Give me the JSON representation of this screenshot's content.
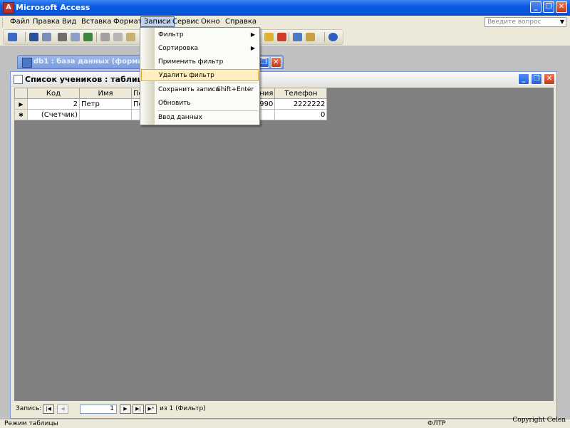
{
  "app": {
    "title": "Microsoft Access"
  },
  "window_buttons": {
    "minimize": "_",
    "restore": "❐",
    "close": "✕"
  },
  "menubar": {
    "items": [
      {
        "label": "Файл"
      },
      {
        "label": "Правка"
      },
      {
        "label": "Вид"
      },
      {
        "label": "Вставка"
      },
      {
        "label": "Формат"
      },
      {
        "label": "Записи"
      },
      {
        "label": "Сервис"
      },
      {
        "label": "Окно"
      },
      {
        "label": "Справка"
      }
    ],
    "help_placeholder": "Введите вопрос"
  },
  "db_window": {
    "title": "db1 : база данных (формат Ac"
  },
  "table_window": {
    "title": "Список учеников : таблица",
    "columns": [
      "Код",
      "Имя",
      "Пе",
      "ждения",
      "Телефон"
    ],
    "rows": [
      {
        "selector": "▶",
        "cells": [
          "2",
          "Петр",
          "Пе",
          "02.1990",
          "2222222"
        ]
      },
      {
        "selector": "✱",
        "cells": [
          "(Счетчик)",
          "",
          "",
          "",
          "0"
        ]
      }
    ]
  },
  "navigator": {
    "label": "Запись:",
    "current": "1",
    "of_text": "из 1 (Фильтр)",
    "buttons": {
      "first": "|◀",
      "prev": "◀",
      "next": "▶",
      "last": "▶|",
      "new": "▶*"
    }
  },
  "dropdown": {
    "items": [
      {
        "label": "Фильтр",
        "submenu": true
      },
      {
        "label": "Сортировка",
        "submenu": true
      },
      {
        "label": "Применить фильтр"
      },
      {
        "label": "Удалить фильтр",
        "highlighted": true
      },
      {
        "label": "Сохранить запись",
        "shortcut": "Shift+Enter"
      },
      {
        "label": "Обновить"
      },
      {
        "label": "Ввод данных"
      }
    ],
    "submenu_arrow": "▶"
  },
  "statusbar": {
    "mode": "Режим таблицы",
    "indicator": "ФЛТР",
    "copyright": "Copyright Celen"
  },
  "colors": {
    "titlebar": "#0a5ce0",
    "mdi_background": "#c0c0c0",
    "datasheet_background": "#808080",
    "menu_highlight": "#ffeebe"
  },
  "toolbar_icons": [
    "view-icon",
    "save-icon",
    "search-icon",
    "print-icon",
    "print-preview-icon",
    "spellcheck-icon",
    "cut-icon",
    "copy-icon",
    "paste-icon",
    "filter-icon",
    "delete-record-icon",
    "database-window-icon",
    "new-object-icon",
    "help-icon"
  ]
}
